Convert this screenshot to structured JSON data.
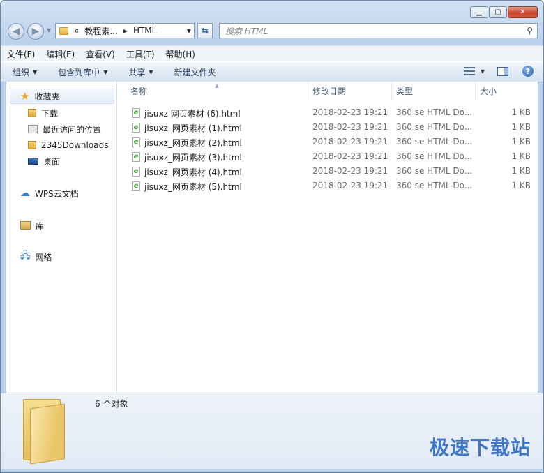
{
  "address": {
    "crumbs": [
      "«",
      "教程素...",
      "HTML"
    ]
  },
  "search": {
    "placeholder": "搜索 HTML"
  },
  "menu": [
    "文件(F)",
    "编辑(E)",
    "查看(V)",
    "工具(T)",
    "帮助(H)"
  ],
  "toolbar": {
    "organize": "组织",
    "include_library": "包含到库中",
    "share": "共享",
    "new_folder": "新建文件夹"
  },
  "sidebar": {
    "favorites": "收藏夹",
    "items": [
      "下载",
      "最近访问的位置",
      "2345Downloads",
      "桌面"
    ],
    "wps": "WPS云文档",
    "libraries": "库",
    "network": "网络"
  },
  "columns": {
    "name": "名称",
    "date": "修改日期",
    "type": "类型",
    "size": "大小"
  },
  "files": [
    {
      "name": "jisuxz 网页素材 (6).html",
      "date": "2018-02-23 19:21",
      "type": "360 se HTML Do...",
      "size": "1 KB"
    },
    {
      "name": "jisuxz_网页素材 (1).html",
      "date": "2018-02-23 19:21",
      "type": "360 se HTML Do...",
      "size": "1 KB"
    },
    {
      "name": "jisuxz_网页素材 (2).html",
      "date": "2018-02-23 19:21",
      "type": "360 se HTML Do...",
      "size": "1 KB"
    },
    {
      "name": "jisuxz_网页素材 (3).html",
      "date": "2018-02-23 19:21",
      "type": "360 se HTML Do...",
      "size": "1 KB"
    },
    {
      "name": "jisuxz_网页素材 (4).html",
      "date": "2018-02-23 19:21",
      "type": "360 se HTML Do...",
      "size": "1 KB"
    },
    {
      "name": "jisuxz_网页素材 (5).html",
      "date": "2018-02-23 19:21",
      "type": "360 se HTML Do...",
      "size": "1 KB"
    }
  ],
  "details": {
    "count": "6 个对象"
  },
  "watermark": "极速下载站",
  "icons": {
    "file": "html-file-icon",
    "favorites": "star-icon",
    "wps": "cloud-icon",
    "libraries": "library-icon",
    "network": "network-icon"
  }
}
